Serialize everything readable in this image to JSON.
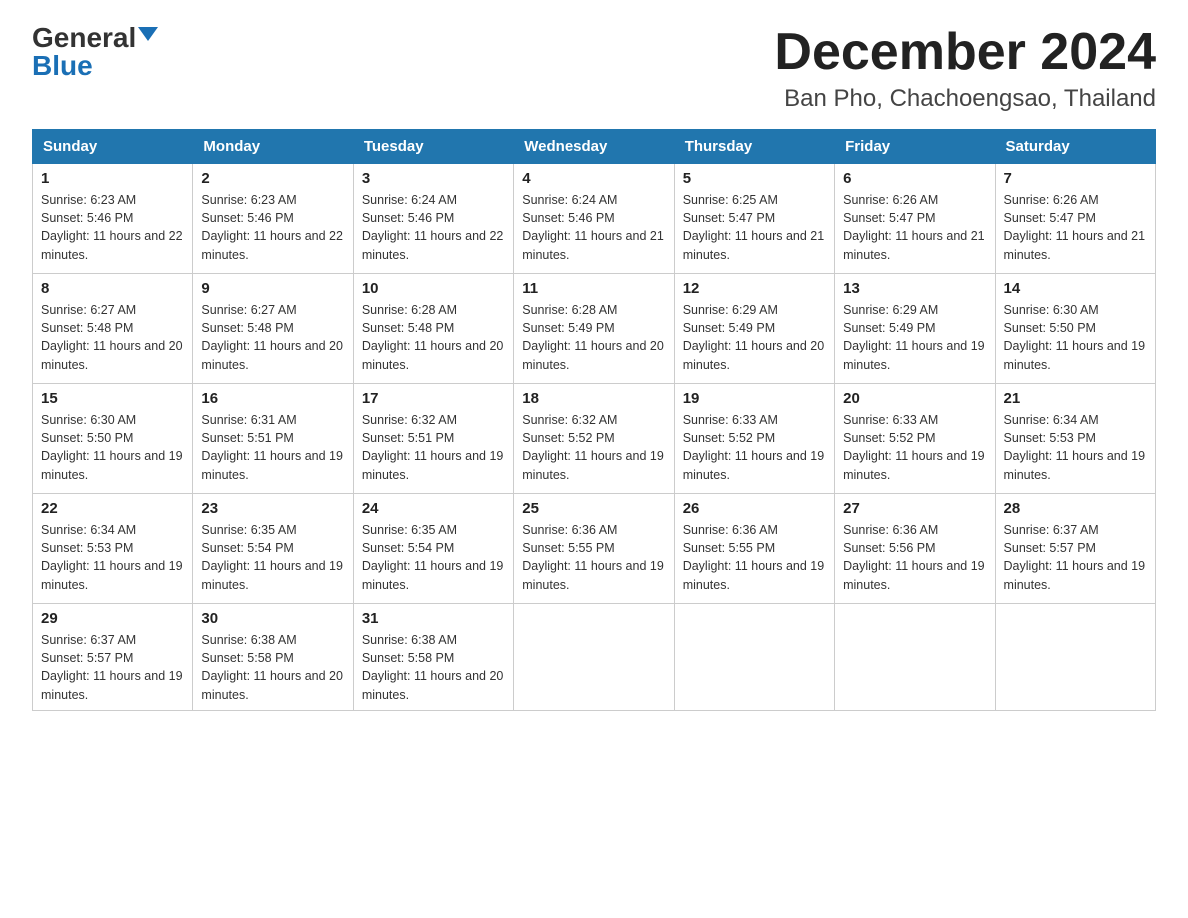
{
  "header": {
    "logo_general": "General",
    "logo_blue": "Blue",
    "month_title": "December 2024",
    "location": "Ban Pho, Chachoengsao, Thailand"
  },
  "days_of_week": [
    "Sunday",
    "Monday",
    "Tuesday",
    "Wednesday",
    "Thursday",
    "Friday",
    "Saturday"
  ],
  "weeks": [
    [
      {
        "day": "1",
        "sunrise": "6:23 AM",
        "sunset": "5:46 PM",
        "daylight": "11 hours and 22 minutes."
      },
      {
        "day": "2",
        "sunrise": "6:23 AM",
        "sunset": "5:46 PM",
        "daylight": "11 hours and 22 minutes."
      },
      {
        "day": "3",
        "sunrise": "6:24 AM",
        "sunset": "5:46 PM",
        "daylight": "11 hours and 22 minutes."
      },
      {
        "day": "4",
        "sunrise": "6:24 AM",
        "sunset": "5:46 PM",
        "daylight": "11 hours and 21 minutes."
      },
      {
        "day": "5",
        "sunrise": "6:25 AM",
        "sunset": "5:47 PM",
        "daylight": "11 hours and 21 minutes."
      },
      {
        "day": "6",
        "sunrise": "6:26 AM",
        "sunset": "5:47 PM",
        "daylight": "11 hours and 21 minutes."
      },
      {
        "day": "7",
        "sunrise": "6:26 AM",
        "sunset": "5:47 PM",
        "daylight": "11 hours and 21 minutes."
      }
    ],
    [
      {
        "day": "8",
        "sunrise": "6:27 AM",
        "sunset": "5:48 PM",
        "daylight": "11 hours and 20 minutes."
      },
      {
        "day": "9",
        "sunrise": "6:27 AM",
        "sunset": "5:48 PM",
        "daylight": "11 hours and 20 minutes."
      },
      {
        "day": "10",
        "sunrise": "6:28 AM",
        "sunset": "5:48 PM",
        "daylight": "11 hours and 20 minutes."
      },
      {
        "day": "11",
        "sunrise": "6:28 AM",
        "sunset": "5:49 PM",
        "daylight": "11 hours and 20 minutes."
      },
      {
        "day": "12",
        "sunrise": "6:29 AM",
        "sunset": "5:49 PM",
        "daylight": "11 hours and 20 minutes."
      },
      {
        "day": "13",
        "sunrise": "6:29 AM",
        "sunset": "5:49 PM",
        "daylight": "11 hours and 19 minutes."
      },
      {
        "day": "14",
        "sunrise": "6:30 AM",
        "sunset": "5:50 PM",
        "daylight": "11 hours and 19 minutes."
      }
    ],
    [
      {
        "day": "15",
        "sunrise": "6:30 AM",
        "sunset": "5:50 PM",
        "daylight": "11 hours and 19 minutes."
      },
      {
        "day": "16",
        "sunrise": "6:31 AM",
        "sunset": "5:51 PM",
        "daylight": "11 hours and 19 minutes."
      },
      {
        "day": "17",
        "sunrise": "6:32 AM",
        "sunset": "5:51 PM",
        "daylight": "11 hours and 19 minutes."
      },
      {
        "day": "18",
        "sunrise": "6:32 AM",
        "sunset": "5:52 PM",
        "daylight": "11 hours and 19 minutes."
      },
      {
        "day": "19",
        "sunrise": "6:33 AM",
        "sunset": "5:52 PM",
        "daylight": "11 hours and 19 minutes."
      },
      {
        "day": "20",
        "sunrise": "6:33 AM",
        "sunset": "5:52 PM",
        "daylight": "11 hours and 19 minutes."
      },
      {
        "day": "21",
        "sunrise": "6:34 AM",
        "sunset": "5:53 PM",
        "daylight": "11 hours and 19 minutes."
      }
    ],
    [
      {
        "day": "22",
        "sunrise": "6:34 AM",
        "sunset": "5:53 PM",
        "daylight": "11 hours and 19 minutes."
      },
      {
        "day": "23",
        "sunrise": "6:35 AM",
        "sunset": "5:54 PM",
        "daylight": "11 hours and 19 minutes."
      },
      {
        "day": "24",
        "sunrise": "6:35 AM",
        "sunset": "5:54 PM",
        "daylight": "11 hours and 19 minutes."
      },
      {
        "day": "25",
        "sunrise": "6:36 AM",
        "sunset": "5:55 PM",
        "daylight": "11 hours and 19 minutes."
      },
      {
        "day": "26",
        "sunrise": "6:36 AM",
        "sunset": "5:55 PM",
        "daylight": "11 hours and 19 minutes."
      },
      {
        "day": "27",
        "sunrise": "6:36 AM",
        "sunset": "5:56 PM",
        "daylight": "11 hours and 19 minutes."
      },
      {
        "day": "28",
        "sunrise": "6:37 AM",
        "sunset": "5:57 PM",
        "daylight": "11 hours and 19 minutes."
      }
    ],
    [
      {
        "day": "29",
        "sunrise": "6:37 AM",
        "sunset": "5:57 PM",
        "daylight": "11 hours and 19 minutes."
      },
      {
        "day": "30",
        "sunrise": "6:38 AM",
        "sunset": "5:58 PM",
        "daylight": "11 hours and 20 minutes."
      },
      {
        "day": "31",
        "sunrise": "6:38 AM",
        "sunset": "5:58 PM",
        "daylight": "11 hours and 20 minutes."
      },
      null,
      null,
      null,
      null
    ]
  ]
}
